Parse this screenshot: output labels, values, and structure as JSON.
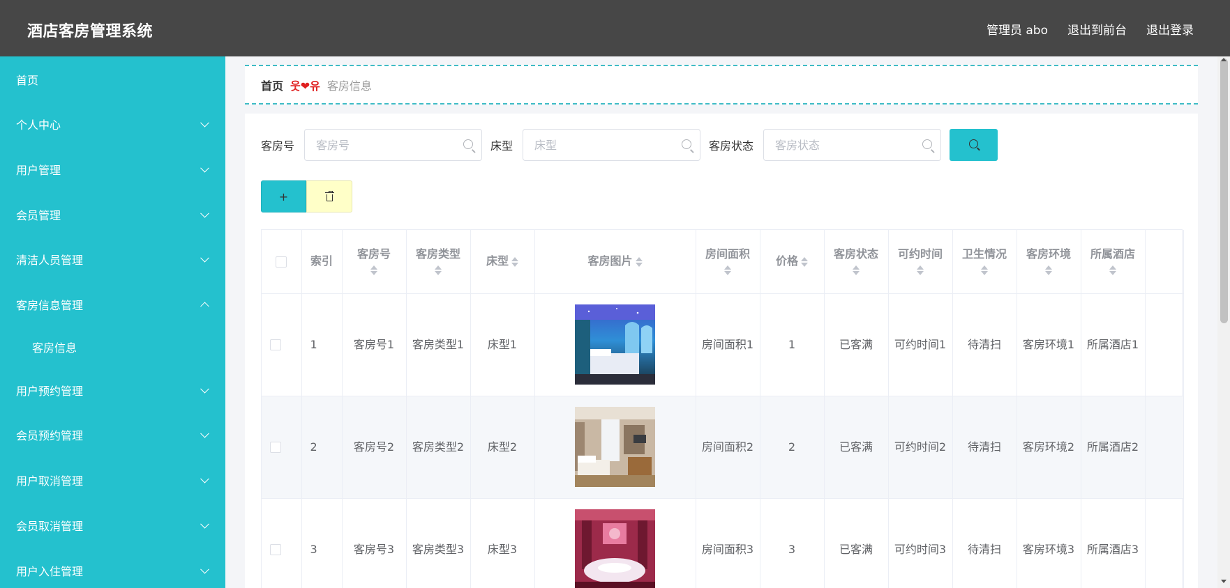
{
  "header": {
    "title": "酒店客房管理系统",
    "admin_label": "管理员 abo",
    "front_label": "退出到前台",
    "logout_label": "退出登录"
  },
  "sidebar": {
    "items": [
      {
        "label": "首页",
        "expandable": false
      },
      {
        "label": "个人中心",
        "expandable": true
      },
      {
        "label": "用户管理",
        "expandable": true
      },
      {
        "label": "会员管理",
        "expandable": true
      },
      {
        "label": "清洁人员管理",
        "expandable": true
      },
      {
        "label": "客房信息管理",
        "expandable": true,
        "expanded": true
      },
      {
        "label": "客房信息",
        "sub": true
      },
      {
        "label": "用户预约管理",
        "expandable": true
      },
      {
        "label": "会员预约管理",
        "expandable": true
      },
      {
        "label": "用户取消管理",
        "expandable": true
      },
      {
        "label": "会员取消管理",
        "expandable": true
      },
      {
        "label": "用户入住管理",
        "expandable": true
      }
    ]
  },
  "breadcrumb": {
    "home": "首页",
    "separator": "웃❤유",
    "current": "客房信息"
  },
  "search": {
    "room_no_label": "客房号",
    "room_no_placeholder": "客房号",
    "bed_label": "床型",
    "bed_placeholder": "床型",
    "status_label": "客房状态",
    "status_placeholder": "客房状态"
  },
  "buttons": {
    "add_label": "+"
  },
  "table": {
    "headers": [
      "索引",
      "客房号",
      "客房类型",
      "床型",
      "客房图片",
      "房间面积",
      "价格",
      "客房状态",
      "可约时间",
      "卫生情况",
      "客房环境",
      "所属酒店"
    ],
    "rows": [
      {
        "index": "1",
        "room_no": "客房号1",
        "room_type": "客房类型1",
        "bed": "床型1",
        "image": "room-photo-blue",
        "area": "房间面积1",
        "price": "1",
        "status": "已客满",
        "time": "可约时间1",
        "hygiene": "待清扫",
        "env": "客房环境1",
        "hotel": "所属酒店1"
      },
      {
        "index": "2",
        "room_no": "客房号2",
        "room_type": "客房类型2",
        "bed": "床型2",
        "image": "room-photo-beige",
        "area": "房间面积2",
        "price": "2",
        "status": "已客满",
        "time": "可约时间2",
        "hygiene": "待清扫",
        "env": "客房环境2",
        "hotel": "所属酒店2"
      },
      {
        "index": "3",
        "room_no": "客房号3",
        "room_type": "客房类型3",
        "bed": "床型3",
        "image": "room-photo-pink",
        "area": "房间面积3",
        "price": "3",
        "status": "已客满",
        "time": "可约时间3",
        "hygiene": "待清扫",
        "env": "客房环境3",
        "hotel": "所属酒店3"
      }
    ]
  },
  "colors": {
    "accent": "#24c1ce",
    "topbar": "#474747",
    "delete_button": "#ffffc8"
  }
}
